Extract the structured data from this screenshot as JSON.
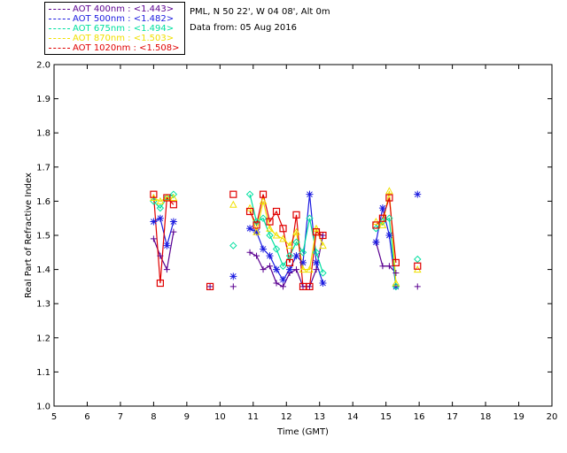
{
  "info": {
    "line1": "PML, N 50 22', W 04 08', Alt 0m",
    "line2": "Data from: 05 Aug 2016"
  },
  "colors": {
    "aot400": "#5a0090",
    "aot500": "#1c1ce0",
    "aot675": "#00e0a0",
    "aot870": "#f0e000",
    "aot1020": "#e00000"
  },
  "chart_data": {
    "type": "scatter",
    "title": "",
    "xlabel": "Time (GMT)",
    "ylabel": "Real Part of Refractive Index",
    "xlim": [
      5,
      20
    ],
    "ylim": [
      1.0,
      2.0
    ],
    "x_ticks": [
      "5",
      "6",
      "7",
      "8",
      "9",
      "10",
      "11",
      "12",
      "13",
      "14",
      "15",
      "16",
      "17",
      "18",
      "19",
      "20"
    ],
    "y_ticks": [
      "1.0",
      "1.1",
      "1.2",
      "1.3",
      "1.4",
      "1.5",
      "1.6",
      "1.7",
      "1.8",
      "1.9",
      "2.0"
    ],
    "grid": false,
    "legend_position": "top-left-outside",
    "series": [
      {
        "name": "AOT  400nm : <1.443>",
        "label_color": "#5a0090",
        "marker": "plus",
        "x": [
          8.0,
          8.2,
          8.4,
          8.6,
          9.7,
          10.4,
          10.9,
          11.1,
          11.3,
          11.5,
          11.7,
          11.9,
          12.1,
          12.3,
          12.5,
          12.7,
          12.9,
          13.1,
          14.7,
          14.9,
          15.1,
          15.3,
          15.95
        ],
        "y": [
          1.49,
          1.44,
          1.4,
          1.51,
          1.35,
          1.35,
          1.45,
          1.44,
          1.4,
          1.41,
          1.36,
          1.35,
          1.39,
          1.4,
          1.35,
          1.35,
          1.4,
          1.5,
          1.48,
          1.41,
          1.41,
          1.39,
          1.35
        ]
      },
      {
        "name": "AOT  500nm : <1.482>",
        "label_color": "#1c1ce0",
        "marker": "asterisk",
        "x": [
          8.0,
          8.2,
          8.4,
          8.6,
          10.4,
          10.9,
          11.1,
          11.3,
          11.5,
          11.7,
          11.9,
          12.1,
          12.3,
          12.5,
          12.7,
          12.9,
          13.1,
          14.7,
          14.9,
          15.1,
          15.3,
          15.95
        ],
        "y": [
          1.54,
          1.55,
          1.47,
          1.54,
          1.38,
          1.52,
          1.51,
          1.46,
          1.44,
          1.4,
          1.37,
          1.4,
          1.44,
          1.42,
          1.62,
          1.42,
          1.36,
          1.48,
          1.58,
          1.5,
          1.35,
          1.62
        ]
      },
      {
        "name": "AOT  675nm : <1.494>",
        "label_color": "#00e0a0",
        "marker": "diamond",
        "x": [
          8.0,
          8.2,
          8.4,
          8.6,
          10.4,
          10.9,
          11.1,
          11.3,
          11.5,
          11.7,
          11.9,
          12.1,
          12.3,
          12.5,
          12.7,
          12.9,
          13.1,
          14.7,
          14.9,
          15.1,
          15.3,
          15.95
        ],
        "y": [
          1.6,
          1.58,
          1.61,
          1.62,
          1.47,
          1.62,
          1.54,
          1.55,
          1.5,
          1.46,
          1.41,
          1.44,
          1.48,
          1.45,
          1.55,
          1.45,
          1.39,
          1.52,
          1.54,
          1.55,
          1.35,
          1.43
        ]
      },
      {
        "name": "AOT  870nm : <1.503>",
        "label_color": "#f0e000",
        "marker": "triangle",
        "x": [
          8.0,
          8.2,
          8.4,
          8.6,
          10.4,
          10.9,
          11.1,
          11.3,
          11.5,
          11.7,
          11.9,
          12.1,
          12.3,
          12.5,
          12.7,
          12.9,
          13.1,
          14.7,
          14.9,
          15.1,
          15.3,
          15.95
        ],
        "y": [
          1.61,
          1.6,
          1.61,
          1.61,
          1.59,
          1.58,
          1.51,
          1.6,
          1.52,
          1.5,
          1.49,
          1.47,
          1.51,
          1.4,
          1.4,
          1.52,
          1.47,
          1.54,
          1.53,
          1.63,
          1.36,
          1.4
        ]
      },
      {
        "name": "AOT 1020nm : <1.508>",
        "label_color": "#e00000",
        "marker": "square",
        "x": [
          8.0,
          8.2,
          8.4,
          8.6,
          9.7,
          10.4,
          10.9,
          11.1,
          11.3,
          11.5,
          11.7,
          11.9,
          12.1,
          12.3,
          12.5,
          12.7,
          12.9,
          13.1,
          14.7,
          14.9,
          15.1,
          15.3,
          15.95
        ],
        "y": [
          1.62,
          1.36,
          1.61,
          1.59,
          1.35,
          1.62,
          1.57,
          1.53,
          1.62,
          1.54,
          1.57,
          1.52,
          1.42,
          1.56,
          1.35,
          1.35,
          1.51,
          1.5,
          1.53,
          1.55,
          1.61,
          1.42,
          1.41
        ]
      }
    ]
  }
}
